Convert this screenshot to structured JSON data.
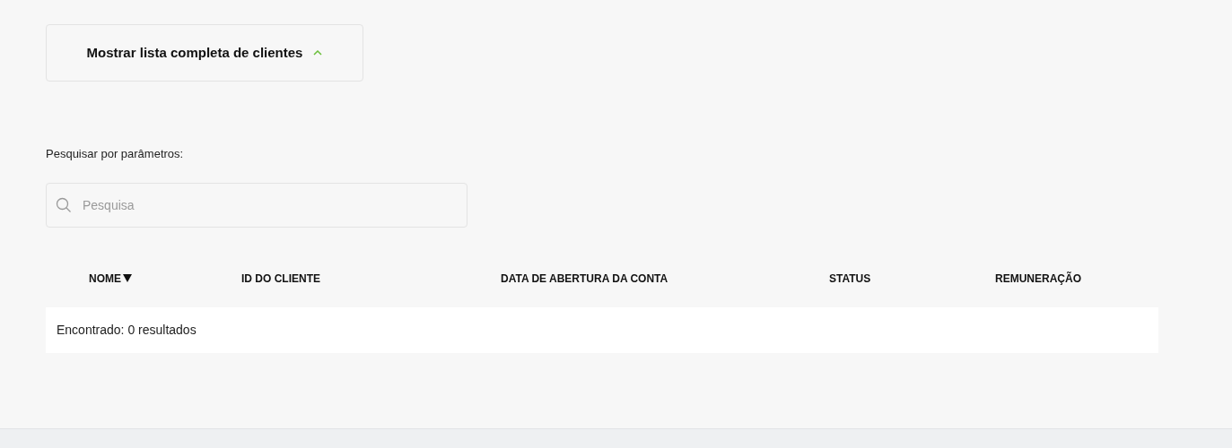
{
  "toggle": {
    "label": "Mostrar lista completa de clientes",
    "expanded": true
  },
  "search": {
    "label": "Pesquisar por parâmetros:",
    "placeholder": "Pesquisa"
  },
  "table": {
    "columns": [
      {
        "label": "NOME",
        "sorted": true
      },
      {
        "label": "ID DO CLIENTE",
        "sorted": false
      },
      {
        "label": "DATA DE ABERTURA DA CONTA",
        "sorted": false
      },
      {
        "label": "STATUS",
        "sorted": false
      },
      {
        "label": "REMUNERAÇÃO",
        "sorted": false
      }
    ],
    "result_text": "Encontrado: 0 resultados"
  }
}
